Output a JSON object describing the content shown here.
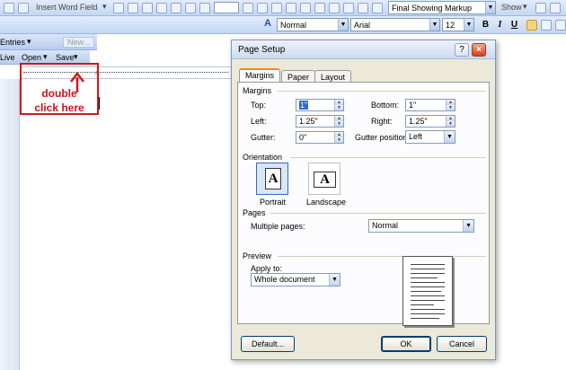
{
  "toolbar": {
    "insert_word_field": "Insert Word Field",
    "style": "Normal",
    "font": "Arial",
    "font_size": "12",
    "markup": "Final Showing Markup",
    "show": "Show",
    "bold": "B",
    "italic": "I",
    "underline": "U"
  },
  "mailmerge": {
    "entries": "Entries",
    "new": "New...",
    "live": "Live",
    "open": "Open",
    "save": "Save"
  },
  "annotation": {
    "line1": "double",
    "line2": "click here",
    "color": "#d01818"
  },
  "dialog": {
    "title": "Page Setup",
    "help": "?",
    "close": "×",
    "tabs": [
      "Margins",
      "Paper",
      "Layout"
    ],
    "margins": {
      "group": "Margins",
      "top_label": "Top:",
      "top_value": "1\"",
      "bottom_label": "Bottom:",
      "bottom_value": "1\"",
      "left_label": "Left:",
      "left_value": "1.25\"",
      "right_label": "Right:",
      "right_value": "1.25\"",
      "gutter_label": "Gutter:",
      "gutter_value": "0\"",
      "gutter_pos_label": "Gutter position:",
      "gutter_pos_value": "Left"
    },
    "orientation": {
      "group": "Orientation",
      "portrait": "Portrait",
      "landscape": "Landscape",
      "icon_letter": "A"
    },
    "pages": {
      "group": "Pages",
      "multiple_label": "Multiple pages:",
      "multiple_value": "Normal"
    },
    "preview": {
      "group": "Preview",
      "apply_label": "Apply to:",
      "apply_value": "Whole document"
    },
    "buttons": {
      "default": "Default...",
      "ok": "OK",
      "cancel": "Cancel"
    }
  }
}
